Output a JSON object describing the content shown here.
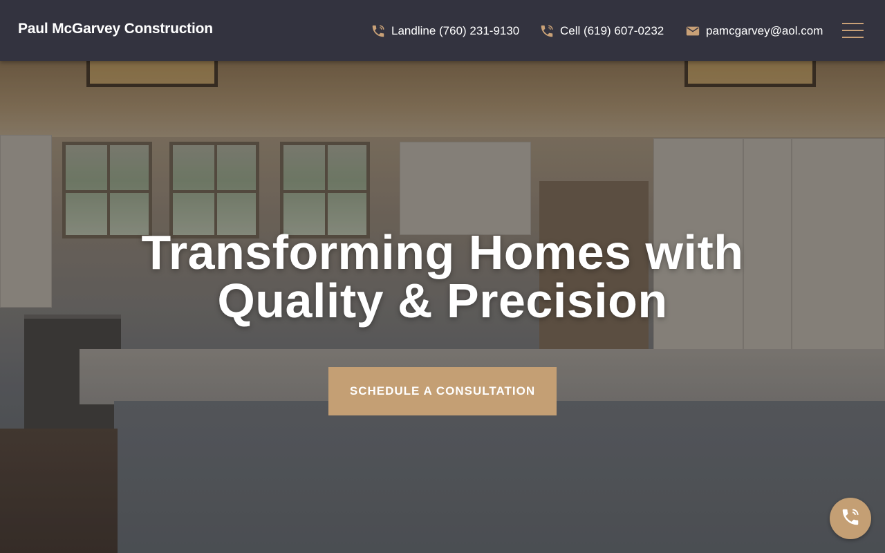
{
  "header": {
    "logo_text": "Paul McGarvey Construction",
    "contacts": [
      {
        "icon": "phone-icon",
        "label": "Landline (760) 231-9130"
      },
      {
        "icon": "phone-icon",
        "label": "Cell (619) 607-0232"
      },
      {
        "icon": "mail-icon",
        "label": "pamcgarvey@aol.com"
      }
    ],
    "menu_icon": "hamburger-menu-icon"
  },
  "hero": {
    "headline_line1": "Transforming Homes with",
    "headline_line2": "Quality & Precision",
    "cta_label": "SCHEDULE A CONSULTATION",
    "background_image": "kitchen-photo"
  },
  "floating_button": {
    "icon": "phone-icon"
  },
  "colors": {
    "header_bg": "#33333f",
    "accent": "#c49f74",
    "text": "#ffffff"
  }
}
